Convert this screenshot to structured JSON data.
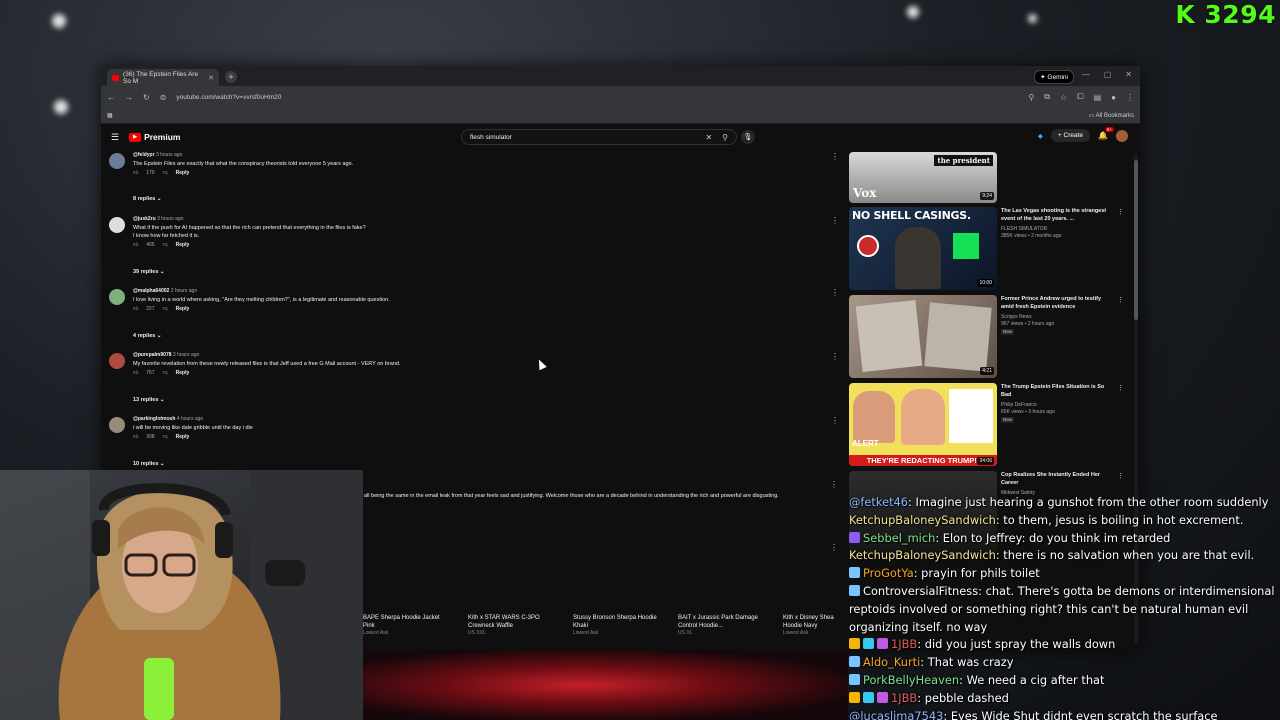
{
  "overlay": {
    "kick_count": "3294",
    "kick_logo": "K",
    "kick_color": "#53fc18"
  },
  "browser": {
    "tab_title": "(36) The Epstein Files Are So M",
    "gemini_label": "Gemini",
    "url": "youtube.com/watch?v=vvrsf0oHm20",
    "all_bookmarks": "All Bookmarks"
  },
  "youtube": {
    "logo_label": "Premium",
    "search_value": "flesh simulator",
    "create_label": "Create",
    "notif_count": "9+"
  },
  "comments": [
    {
      "author": "@feldypr",
      "time": "3 hours ago",
      "text": "The Epstein Files are exactly that what the conspiracy theorists told everyone 5 years ago.",
      "likes": "170",
      "replies": "8 replies",
      "avatar_color": "#6c7d99"
    },
    {
      "author": "@jusk2ru",
      "time": "3 hours ago",
      "text": "What if the push for AI happened so that the rich can pretend that everything in the files is fake?",
      "text2": "I know how far fetched it is.",
      "likes": "405",
      "replies": "39 replies",
      "avatar_color": "#dedede"
    },
    {
      "author": "@malpha64002",
      "time": "2 hours ago",
      "text": "I love living in a world where asking, \"Are they melting children?\", is a legitimate and reasonable question.",
      "likes": "227",
      "replies": "4 replies",
      "avatar_color": "#7fb07a"
    },
    {
      "author": "@purepalm9078",
      "time": "3 hours ago",
      "text": "My favorite revelation from these newly released files is that Jeff used a free G Mail account - VERY on brand.",
      "likes": "757",
      "replies": "13 replies",
      "avatar_color": "#b04a3f"
    },
    {
      "author": "@parkinglotmosh",
      "time": "4 hours ago",
      "text": "i will be moving like dale gribble until the day i die",
      "likes": "308",
      "replies": "10 replies",
      "avatar_color": "#9a8a78"
    }
  ],
  "reply_label": "Reply",
  "partial_comment": "all being the same in the email leak from that year feels sad and justifying. Welcome those who are a decade behind in understanding the rich and powerful are disgusting.",
  "sidebar_videos": [
    {
      "title": "",
      "channel": "",
      "stats": "",
      "duration": "9:24",
      "thumb_text": "the president",
      "thumb_brand": "Vox",
      "thumb_bg": "#d9d9d9"
    },
    {
      "title": "The Las Vegas shooting is the strangest event of the last 20 years. ...",
      "channel": "FLESH SIMULATOR",
      "stats": "385K views • 2 months ago",
      "duration": "10:00",
      "thumb_text": "NO SHELL CASINGS.",
      "thumb_bg": "#223a5a"
    },
    {
      "title": "Former Prince Andrew urged to testify amid fresh Epstein evidence",
      "channel": "Scripps News",
      "stats": "967 views • 2 hours ago",
      "badge": "New",
      "duration": "4:21",
      "thumb_bg": "#7a6a5a"
    },
    {
      "title": "The Trump Epstein Files Situation is So Bad",
      "channel": "Philip DeFranco",
      "stats": "65K views • 3 hours ago",
      "badge": "New",
      "duration": "34:06",
      "thumb_text": "THEY'RE REDACTING TRUMP!!",
      "thumb_alert": "ALERT",
      "thumb_bg": "#c9b43a"
    },
    {
      "title": "Cop Realizes She Instantly Ended Her Career",
      "channel": "Midwest Safety",
      "stats": "",
      "duration": "",
      "thumb_bg": "#333"
    }
  ],
  "ads": [
    {
      "name": "BAPE Sherpa Hoodie Jacket Pink",
      "sub": "Lowest Ask"
    },
    {
      "name": "Kith x STAR WARS C-3PO Crewneck Waffle",
      "sub": "US XXL"
    },
    {
      "name": "Stussy Bronson Sherpa Hoodie Khaki",
      "sub": "Lowest Ask"
    },
    {
      "name": "BAIT x Jurassic Park Damage Control Hoodie...",
      "sub": "US XL"
    },
    {
      "name": "Kith x Disney Shea Hoodie Navy",
      "sub": "Lowest Ask"
    }
  ],
  "chat": [
    {
      "user": "@fetket46",
      "color": "#8fb7ff",
      "badges": [],
      "text": "Imagine just hearing a gunshot from the other room suddenly",
      "reply": true
    },
    {
      "user": "KetchupBaloneySandwich",
      "color": "#f2e79a",
      "badges": [],
      "text": "to them, jesus is boiling in hot excrement."
    },
    {
      "user": "Sebbel_mich",
      "color": "#7ee38a",
      "badges": [
        "#8b5cf6"
      ],
      "text": "Elon to Jeffrey: do you think im retarded"
    },
    {
      "user": "KetchupBaloneySandwich",
      "color": "#f2e79a",
      "badges": [],
      "text": "there is no salvation when you are that evil."
    },
    {
      "user": "ProGotYa",
      "color": "#f5a623",
      "badges": [
        "#7ac4ff"
      ],
      "text": "prayin for phils toilet"
    },
    {
      "user": "ControversialFitness",
      "color": "#ffffff",
      "badges": [
        "#7ac4ff"
      ],
      "text": "chat. There's gotta be demons or interdimensional reptoids involved or something right? this can't be natural human evil organizing itself. no way"
    },
    {
      "user": "1JBB",
      "color": "#e05a5a",
      "badges": [
        "#f7b500",
        "#37c8f0",
        "#c05ae0"
      ],
      "text": "did you just spray the walls down"
    },
    {
      "user": "Aldo_Kurti",
      "color": "#f5a623",
      "badges": [
        "#7ac4ff"
      ],
      "text": "That was crazy"
    },
    {
      "user": "PorkBellyHeaven",
      "color": "#7ee38a",
      "badges": [
        "#7ac4ff"
      ],
      "text": "We need a cig after that"
    },
    {
      "user": "1JBB",
      "color": "#e05a5a",
      "badges": [
        "#f7b500",
        "#37c8f0",
        "#c05ae0"
      ],
      "text": "pebble dashed"
    },
    {
      "user": "@lucaslima7543",
      "color": "#8fb7ff",
      "badges": [],
      "text": "Eyes Wide Shut didnt even scratch the surface"
    }
  ]
}
